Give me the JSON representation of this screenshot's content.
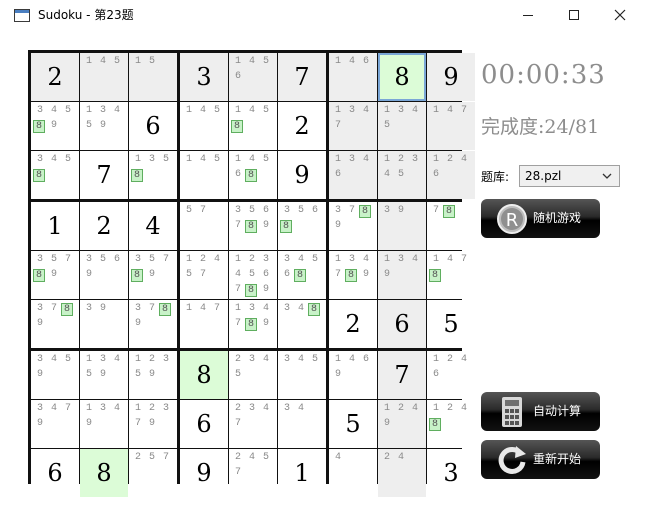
{
  "window": {
    "title": "Sudoku - 第23题",
    "minimize_icon": "minimize-icon",
    "maximize_icon": "maximize-icon",
    "close_icon": "close-icon"
  },
  "grid": {
    "rows": [
      [
        {
          "v": "2",
          "bg": "gray"
        },
        {
          "c": [
            1,
            4,
            5
          ],
          "bg": "gray"
        },
        {
          "c": [
            1,
            5
          ],
          "bg": "gray"
        },
        {
          "v": "3",
          "bg": "gray"
        },
        {
          "c": [
            1,
            4,
            5,
            6
          ],
          "bg": "gray"
        },
        {
          "v": "7",
          "bg": "gray"
        },
        {
          "c": [
            1,
            4,
            6
          ],
          "bg": "gray"
        },
        {
          "v": "8",
          "bg": "green",
          "sel": true
        },
        {
          "v": "9",
          "bg": "gray"
        }
      ],
      [
        {
          "c": [
            3,
            4,
            5,
            8,
            9
          ],
          "h": [
            8
          ]
        },
        {
          "c": [
            1,
            3,
            4,
            5,
            9
          ]
        },
        {
          "v": "6"
        },
        {
          "c": [
            1,
            4,
            5
          ]
        },
        {
          "c": [
            1,
            4,
            5,
            8
          ],
          "h": [
            8
          ]
        },
        {
          "v": "2"
        },
        {
          "c": [
            1,
            3,
            4,
            7
          ],
          "bg": "gray"
        },
        {
          "c": [
            1,
            3,
            4,
            5
          ],
          "bg": "gray"
        },
        {
          "c": [
            1,
            4,
            7
          ],
          "bg": "gray"
        }
      ],
      [
        {
          "c": [
            3,
            4,
            5,
            8
          ],
          "h": [
            8
          ]
        },
        {
          "v": "7"
        },
        {
          "c": [
            1,
            3,
            5,
            8
          ],
          "h": [
            8
          ]
        },
        {
          "c": [
            1,
            4,
            5
          ]
        },
        {
          "c": [
            1,
            4,
            5,
            6,
            8
          ],
          "h": [
            8
          ]
        },
        {
          "v": "9"
        },
        {
          "c": [
            1,
            3,
            4,
            6
          ],
          "bg": "gray"
        },
        {
          "c": [
            1,
            2,
            3,
            4,
            5
          ],
          "bg": "gray"
        },
        {
          "c": [
            1,
            2,
            4,
            6
          ],
          "bg": "gray"
        }
      ],
      [
        {
          "v": "1"
        },
        {
          "v": "2"
        },
        {
          "v": "4"
        },
        {
          "c": [
            5,
            7
          ]
        },
        {
          "c": [
            3,
            5,
            6,
            7,
            8,
            9
          ],
          "h": [
            8
          ]
        },
        {
          "c": [
            3,
            5,
            6,
            8
          ],
          "h": [
            8
          ]
        },
        {
          "c": [
            3,
            7,
            8,
            9
          ],
          "h": [
            8
          ]
        },
        {
          "c": [
            3,
            9
          ],
          "bg": "gray"
        },
        {
          "c": [
            7,
            8
          ],
          "h": [
            8
          ]
        }
      ],
      [
        {
          "c": [
            3,
            5,
            7,
            8,
            9
          ],
          "h": [
            8
          ]
        },
        {
          "c": [
            3,
            5,
            6,
            9
          ]
        },
        {
          "c": [
            3,
            5,
            7,
            8,
            9
          ],
          "h": [
            8
          ]
        },
        {
          "c": [
            1,
            2,
            4,
            5,
            7
          ]
        },
        {
          "c": [
            1,
            2,
            3,
            4,
            5,
            6,
            7,
            8,
            9
          ],
          "h": [
            8
          ]
        },
        {
          "c": [
            3,
            4,
            5,
            6,
            8
          ],
          "h": [
            8
          ]
        },
        {
          "c": [
            1,
            3,
            4,
            7,
            8,
            9
          ],
          "h": [
            8
          ]
        },
        {
          "c": [
            1,
            3,
            4,
            9
          ],
          "bg": "gray"
        },
        {
          "c": [
            1,
            4,
            7,
            8
          ],
          "h": [
            8
          ]
        }
      ],
      [
        {
          "c": [
            3,
            7,
            8,
            9
          ],
          "h": [
            8
          ]
        },
        {
          "c": [
            3,
            9
          ]
        },
        {
          "c": [
            3,
            7,
            8,
            9
          ],
          "h": [
            8
          ]
        },
        {
          "c": [
            1,
            4,
            7
          ]
        },
        {
          "c": [
            1,
            3,
            4,
            7,
            8,
            9
          ],
          "h": [
            8
          ]
        },
        {
          "c": [
            3,
            4,
            8
          ],
          "h": [
            8
          ]
        },
        {
          "v": "2"
        },
        {
          "v": "6",
          "bg": "gray"
        },
        {
          "v": "5"
        }
      ],
      [
        {
          "c": [
            3,
            4,
            5,
            9
          ]
        },
        {
          "c": [
            1,
            3,
            4,
            5,
            9
          ]
        },
        {
          "c": [
            1,
            2,
            3,
            5,
            9
          ]
        },
        {
          "v": "8",
          "bg": "green"
        },
        {
          "c": [
            2,
            3,
            4,
            5
          ]
        },
        {
          "c": [
            3,
            4,
            5
          ]
        },
        {
          "c": [
            1,
            4,
            6,
            9
          ]
        },
        {
          "v": "7",
          "bg": "gray"
        },
        {
          "c": [
            1,
            2,
            4,
            6
          ]
        }
      ],
      [
        {
          "c": [
            3,
            4,
            7,
            9
          ]
        },
        {
          "c": [
            1,
            3,
            4,
            9
          ]
        },
        {
          "c": [
            1,
            2,
            3,
            7,
            9
          ]
        },
        {
          "v": "6"
        },
        {
          "c": [
            2,
            3,
            4,
            7
          ]
        },
        {
          "c": [
            3,
            4
          ]
        },
        {
          "v": "5"
        },
        {
          "c": [
            1,
            2,
            4,
            9
          ],
          "bg": "gray"
        },
        {
          "c": [
            1,
            2,
            4,
            8
          ],
          "h": [
            8
          ]
        }
      ],
      [
        {
          "v": "6"
        },
        {
          "v": "8",
          "bg": "green"
        },
        {
          "c": [
            2,
            5,
            7
          ]
        },
        {
          "v": "9"
        },
        {
          "c": [
            2,
            4,
            5,
            7
          ]
        },
        {
          "v": "1"
        },
        {
          "c": [
            4
          ]
        },
        {
          "c": [
            2,
            4
          ],
          "bg": "gray"
        },
        {
          "v": "3"
        }
      ]
    ]
  },
  "side": {
    "timer": "00:00:33",
    "progress": "完成度:24/81",
    "library_label": "题库:",
    "library_value": "28.pzl",
    "random_button": "随机游戏",
    "auto_button": "自动计算",
    "restart_button": "重新开始",
    "random_icon": "r-circle-icon",
    "auto_icon": "calculator-icon",
    "restart_icon": "refresh-icon"
  }
}
